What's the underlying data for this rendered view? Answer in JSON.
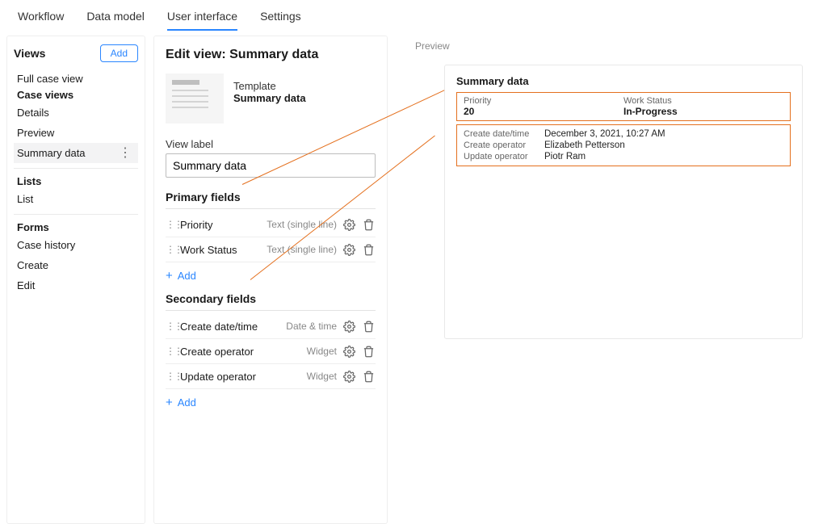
{
  "tabs": [
    "Workflow",
    "Data model",
    "User interface",
    "Settings"
  ],
  "activeTab": "User interface",
  "sidebar": {
    "title": "Views",
    "add": "Add",
    "rootItems": [
      "Full case view"
    ],
    "sections": [
      {
        "title": "Case views",
        "items": [
          "Details",
          "Preview",
          "Summary data"
        ],
        "selected": "Summary data"
      },
      {
        "title": "Lists",
        "items": [
          "List"
        ]
      },
      {
        "title": "Forms",
        "items": [
          "Case history",
          "Create",
          "Edit"
        ]
      }
    ]
  },
  "editPanel": {
    "heading": "Edit view: Summary data",
    "templateLabel": "Template",
    "templateName": "Summary data",
    "viewLabelText": "View label",
    "viewLabelValue": "Summary data",
    "primaryTitle": "Primary fields",
    "secondaryTitle": "Secondary fields",
    "addLabel": "Add",
    "primaryFields": [
      {
        "name": "Priority",
        "type": "Text (single line)"
      },
      {
        "name": "Work Status",
        "type": "Text (single line)"
      }
    ],
    "secondaryFields": [
      {
        "name": "Create date/time",
        "type": "Date & time"
      },
      {
        "name": "Create operator",
        "type": "Widget"
      },
      {
        "name": "Update operator",
        "type": "Widget"
      }
    ]
  },
  "preview": {
    "label": "Preview",
    "cardTitle": "Summary data",
    "primary": [
      {
        "label": "Priority",
        "value": "20"
      },
      {
        "label": "Work Status",
        "value": "In-Progress"
      }
    ],
    "secondary": [
      {
        "label": "Create date/time",
        "value": "December 3, 2021, 10:27 AM"
      },
      {
        "label": "Create operator",
        "value": "Elizabeth Petterson"
      },
      {
        "label": "Update operator",
        "value": "Piotr Ram"
      }
    ]
  },
  "icons": {
    "gear": "gear-icon",
    "trash": "trash-icon",
    "drag": "drag-handle-icon",
    "plus": "plus-icon",
    "kebab": "kebab-icon"
  }
}
